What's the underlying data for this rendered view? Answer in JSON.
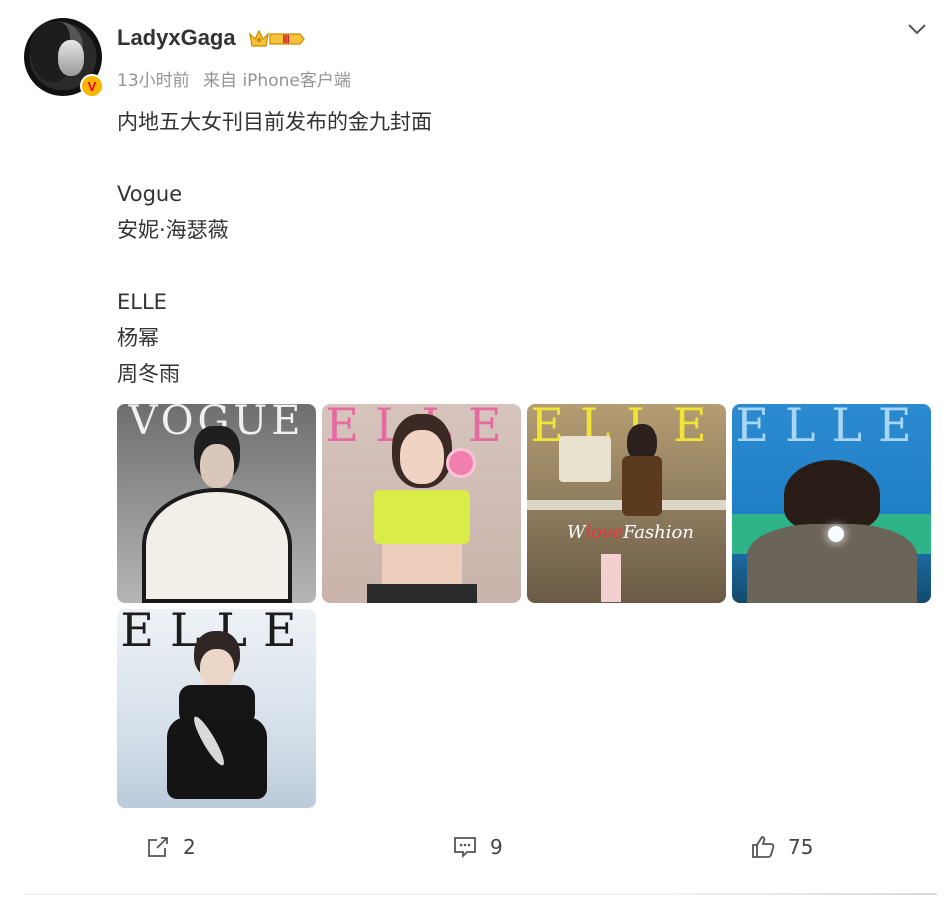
{
  "post": {
    "username": "LadyxGaga",
    "vip_level": "Ⅲ",
    "verified_mark": "V",
    "time": "13小时前",
    "source": "来自 iPhone客户端",
    "text_lines": [
      "内地五大女刊目前发布的金九封面",
      "",
      "Vogue",
      "安妮·海瑟薇",
      "",
      "ELLE",
      "杨幂",
      "周冬雨"
    ],
    "images": [
      {
        "name": "vogue-cover",
        "title": "VOGUE",
        "bg": "#8a8a8a"
      },
      {
        "name": "elle-cover-yangmi",
        "title": "ELLE",
        "bg": "#d8c6bf"
      },
      {
        "name": "elle-cover-retro",
        "title": "ELLE",
        "bg": "#9a8a70"
      },
      {
        "name": "elle-cover-blue",
        "title": "ELLE",
        "bg": "#2a86c7"
      },
      {
        "name": "elle-cover-zhoudongyu",
        "title": "ELLE",
        "bg": "#d9e3ec"
      }
    ]
  },
  "actions": {
    "repost_count": "2",
    "comment_count": "9",
    "like_count": "75"
  },
  "icons": [
    "vip-crown-icon",
    "chevron-down-icon",
    "repost-icon",
    "comment-icon",
    "like-icon"
  ],
  "colors": {
    "verified": "#f7b500",
    "meta": "#939393",
    "text": "#333333"
  }
}
